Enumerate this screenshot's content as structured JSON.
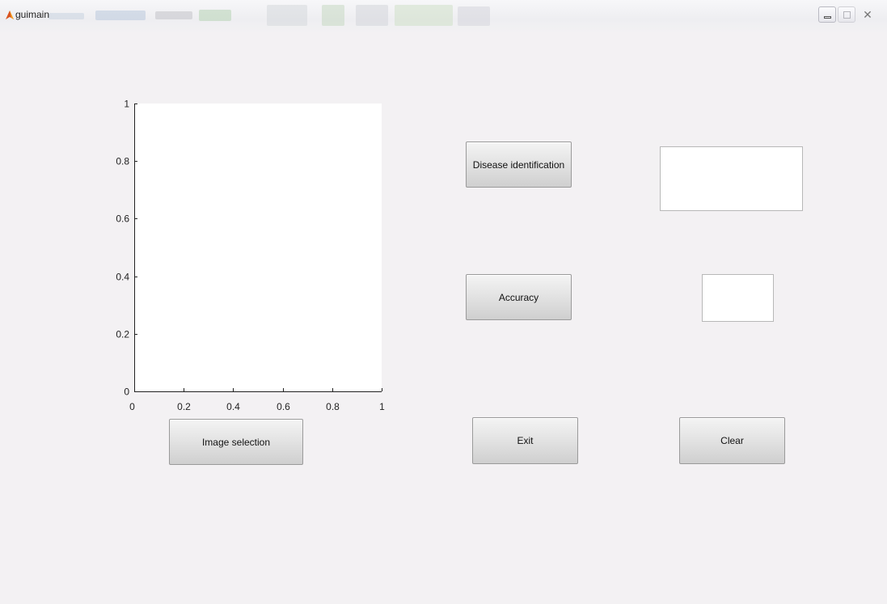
{
  "window": {
    "title": "guimain"
  },
  "axes": {
    "xlim": [
      0,
      1
    ],
    "ylim": [
      0,
      1
    ],
    "x_ticks": [
      {
        "value": 0,
        "label": "0"
      },
      {
        "value": 0.2,
        "label": "0.2"
      },
      {
        "value": 0.4,
        "label": "0.4"
      },
      {
        "value": 0.6,
        "label": "0.6"
      },
      {
        "value": 0.8,
        "label": "0.8"
      },
      {
        "value": 1,
        "label": "1"
      }
    ],
    "y_ticks": [
      {
        "value": 0,
        "label": "0"
      },
      {
        "value": 0.2,
        "label": "0.2"
      },
      {
        "value": 0.4,
        "label": "0.4"
      },
      {
        "value": 0.6,
        "label": "0.6"
      },
      {
        "value": 0.8,
        "label": "0.8"
      },
      {
        "value": 1,
        "label": "1"
      }
    ]
  },
  "buttons": {
    "disease_identification": "Disease identification",
    "accuracy": "Accuracy",
    "image_selection": "Image selection",
    "exit": "Exit",
    "clear": "Clear"
  },
  "outputs": {
    "disease_result": "",
    "accuracy_result": ""
  },
  "colors": {
    "background": "#f3f1f3",
    "axes_background": "#ffffff"
  }
}
